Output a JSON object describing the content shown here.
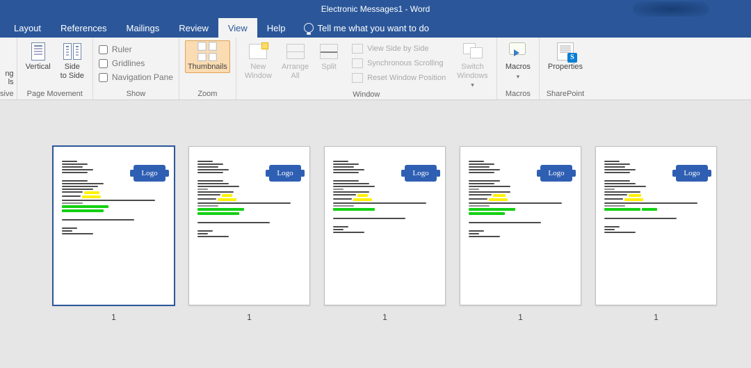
{
  "title": "Electronic Messages1  -  Word",
  "tabs": {
    "layout": "Layout",
    "references": "References",
    "mailings": "Mailings",
    "review": "Review",
    "view": "View",
    "help": "Help"
  },
  "tell_me": "Tell me what you want to do",
  "ribbon": {
    "page_movement": {
      "vertical": "Vertical",
      "side_to_side": "Side\nto Side",
      "group_label": "Page Movement"
    },
    "show": {
      "ruler": "Ruler",
      "gridlines": "Gridlines",
      "nav_pane": "Navigation Pane",
      "group_label": "Show"
    },
    "zoom": {
      "thumbnails": "Thumbnails",
      "group_label": "Zoom"
    },
    "window": {
      "new_window": "New\nWindow",
      "arrange_all": "Arrange\nAll",
      "split": "Split",
      "side_by_side": "View Side by Side",
      "sync_scroll": "Synchronous Scrolling",
      "reset_pos": "Reset Window Position",
      "switch": "Switch\nWindows",
      "group_label": "Window"
    },
    "macros": {
      "label": "Macros",
      "group_label": "Macros"
    },
    "sharepoint": {
      "label": "Properties",
      "group_label": "SharePoint"
    }
  },
  "thumbnails": {
    "logo_text": "Logo",
    "page_nums": [
      "1",
      "1",
      "1",
      "1",
      "1"
    ]
  },
  "truncated_left": {
    "line1": "ng",
    "line2": "ls",
    "line3": "sive"
  }
}
